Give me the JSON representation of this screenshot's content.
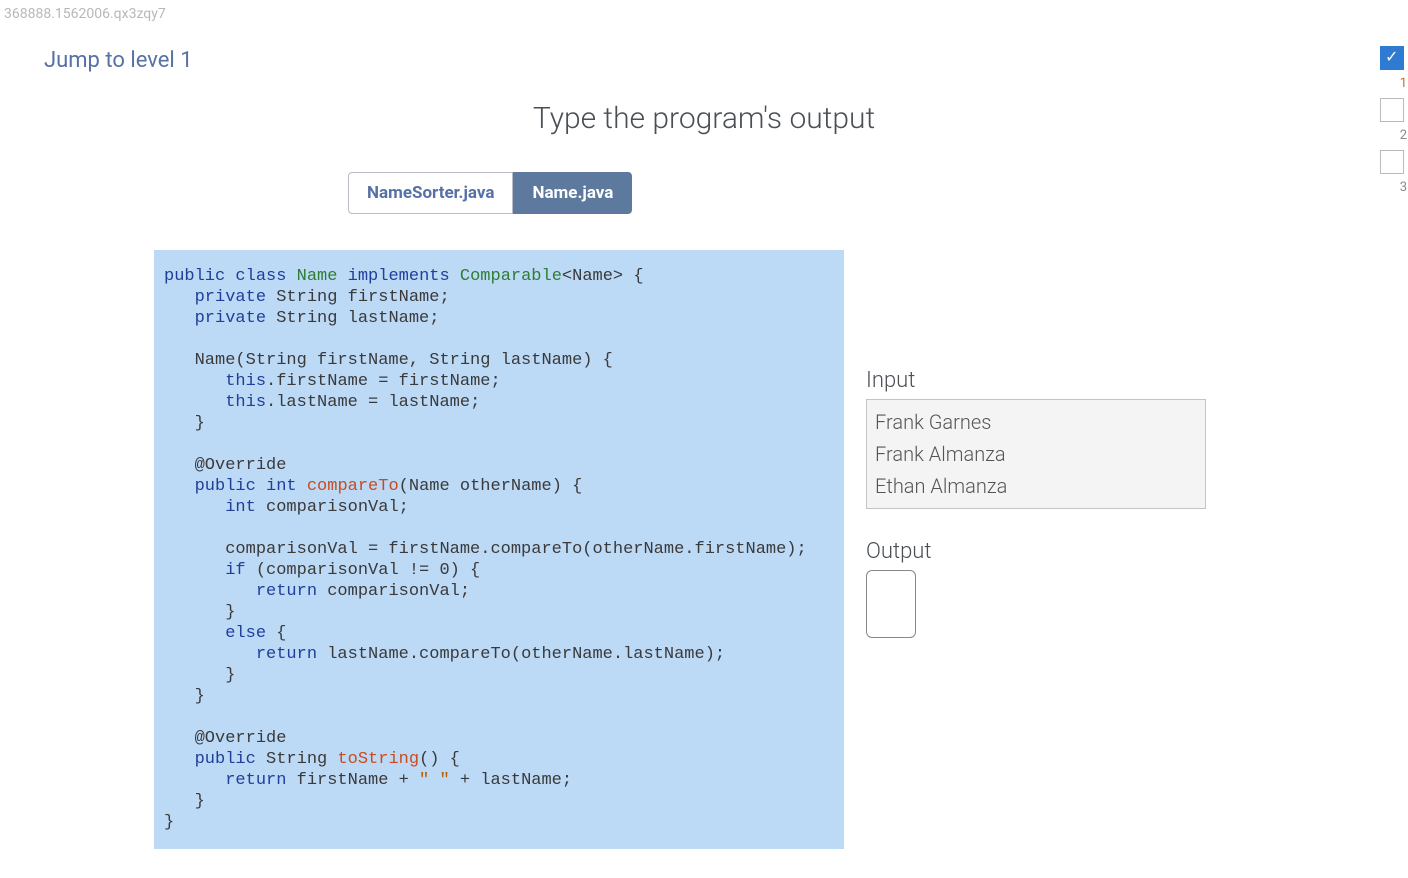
{
  "meta_id": "368888.1562006.qx3zqy7",
  "jump_label": "Jump to level 1",
  "prompt": "Type the program's output",
  "tabs": [
    {
      "label": "NameSorter.java",
      "active": false
    },
    {
      "label": "Name.java",
      "active": true
    }
  ],
  "code": {
    "l1a": "public",
    "l1b": " ",
    "l1c": "class",
    "l1d": " ",
    "l1e": "Name",
    "l1f": " ",
    "l1g": "implements",
    "l1h": " ",
    "l1i": "Comparable",
    "l1j": "<Name> {",
    "l2a": "   private",
    "l2b": " String firstName;",
    "l3a": "   private",
    "l3b": " String lastName;",
    "l4": "",
    "l5": "   Name(String firstName, String lastName) {",
    "l6a": "      this",
    "l6b": ".firstName = firstName;",
    "l7a": "      this",
    "l7b": ".lastName = lastName;",
    "l8": "   }",
    "l9": "",
    "l10": "   @Override",
    "l11a": "   public",
    "l11b": " ",
    "l11c": "int",
    "l11d": " ",
    "l11e": "compareTo",
    "l11f": "(Name otherName) {",
    "l12a": "      int",
    "l12b": " comparisonVal;",
    "l13": "",
    "l14": "      comparisonVal = firstName.compareTo(otherName.firstName);",
    "l15a": "      if",
    "l15b": " (comparisonVal != 0) {",
    "l16a": "         return",
    "l16b": " comparisonVal;",
    "l17": "      }",
    "l18a": "      else",
    "l18b": " {",
    "l19a": "         return",
    "l19b": " lastName.compareTo(otherName.lastName);",
    "l20": "      }",
    "l21": "   }",
    "l22": "",
    "l23": "   @Override",
    "l24a": "   public",
    "l24b": " String ",
    "l24c": "toString",
    "l24d": "() {",
    "l25a": "      return",
    "l25b": " firstName + ",
    "l25c": "\" \"",
    "l25d": " + lastName;",
    "l26": "   }",
    "l27": "}"
  },
  "input_label": "Input",
  "input_lines": [
    "Frank Garnes",
    "Frank Almanza",
    "Ethan Almanza"
  ],
  "output_label": "Output",
  "progress": [
    {
      "done": true,
      "num": "1"
    },
    {
      "done": false,
      "num": "2"
    },
    {
      "done": false,
      "num": "3"
    }
  ]
}
